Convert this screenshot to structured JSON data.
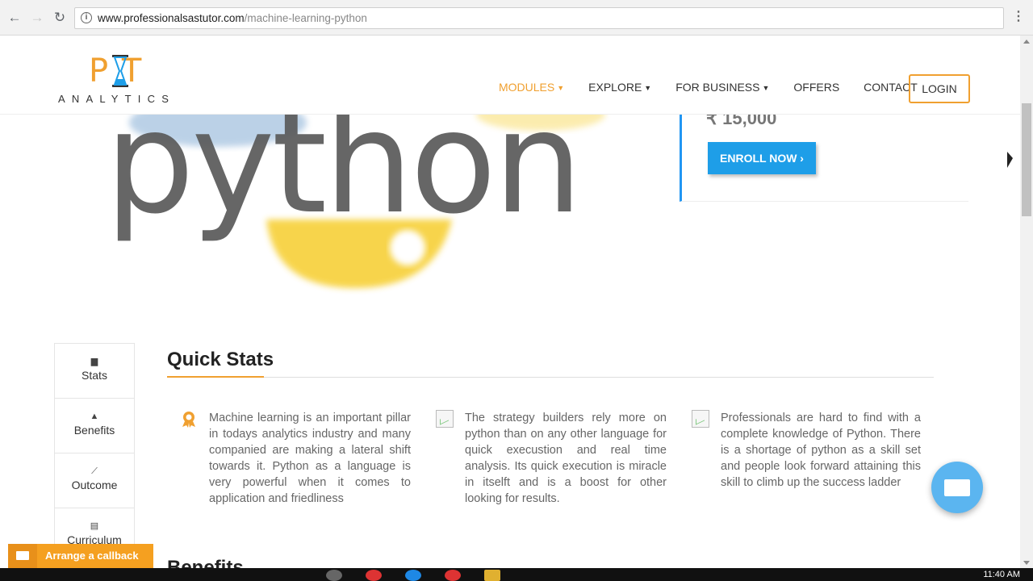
{
  "browser": {
    "url_domain": "www.professionalsastutor.com",
    "url_path": "/machine-learning-python",
    "info_icon_glyph": "i",
    "back_glyph": "←",
    "forward_glyph": "→",
    "reload_glyph": "↻",
    "menu_glyph": "⋮"
  },
  "logo": {
    "mark": "P T",
    "text": "ANALYTICS"
  },
  "nav": {
    "items": [
      {
        "label": "MODULES",
        "caret": "▼",
        "active": true
      },
      {
        "label": "EXPLORE",
        "caret": "▼",
        "active": false
      },
      {
        "label": "FOR BUSINESS",
        "caret": "▼",
        "active": false
      },
      {
        "label": "OFFERS",
        "caret": "",
        "active": false
      },
      {
        "label": "CONTACT",
        "caret": "",
        "active": false
      }
    ],
    "login_label": "LOGIN"
  },
  "hero": {
    "logo_word": "python",
    "price": "₹ 15,000",
    "enroll_label": "ENROLL NOW ›"
  },
  "side_tabs": [
    {
      "label": "Stats",
      "icon": "book-icon",
      "glyph": "▆"
    },
    {
      "label": "Benefits",
      "icon": "thumbs-up-icon",
      "glyph": "▲"
    },
    {
      "label": "Outcome",
      "icon": "line-chart-icon",
      "glyph": "⟋"
    },
    {
      "label": "Curriculum",
      "icon": "list-icon",
      "glyph": "▤"
    }
  ],
  "quick_stats": {
    "title": "Quick Stats",
    "items": [
      {
        "icon": "award-icon",
        "text": "Machine learning is an important pillar in todays analytics industry and many companied are making a lateral shift towards it. Python as a language is very powerful when it comes to application and friedliness"
      },
      {
        "icon": "broken-image-icon",
        "text": "The strategy builders rely more on python than on any other language for quick execustion and real time analysis. Its quick execution is miracle in itselft and is a boost for other looking for results."
      },
      {
        "icon": "broken-image-icon",
        "text": "Professionals are hard to find with a complete knowledge of Python. There is a shortage of python as a skill set and people look forward attaining this skill to climb up the success ladder"
      }
    ],
    "next_heading": "Benefits"
  },
  "callback": {
    "label": "Arrange a callback"
  },
  "taskbar": {
    "clock": "11:40 AM"
  },
  "colors": {
    "accent_orange": "#f0a030",
    "enroll_blue": "#1e9ee8",
    "panel_border_blue": "#2196f3",
    "chat_blue": "#5bb5f0"
  }
}
